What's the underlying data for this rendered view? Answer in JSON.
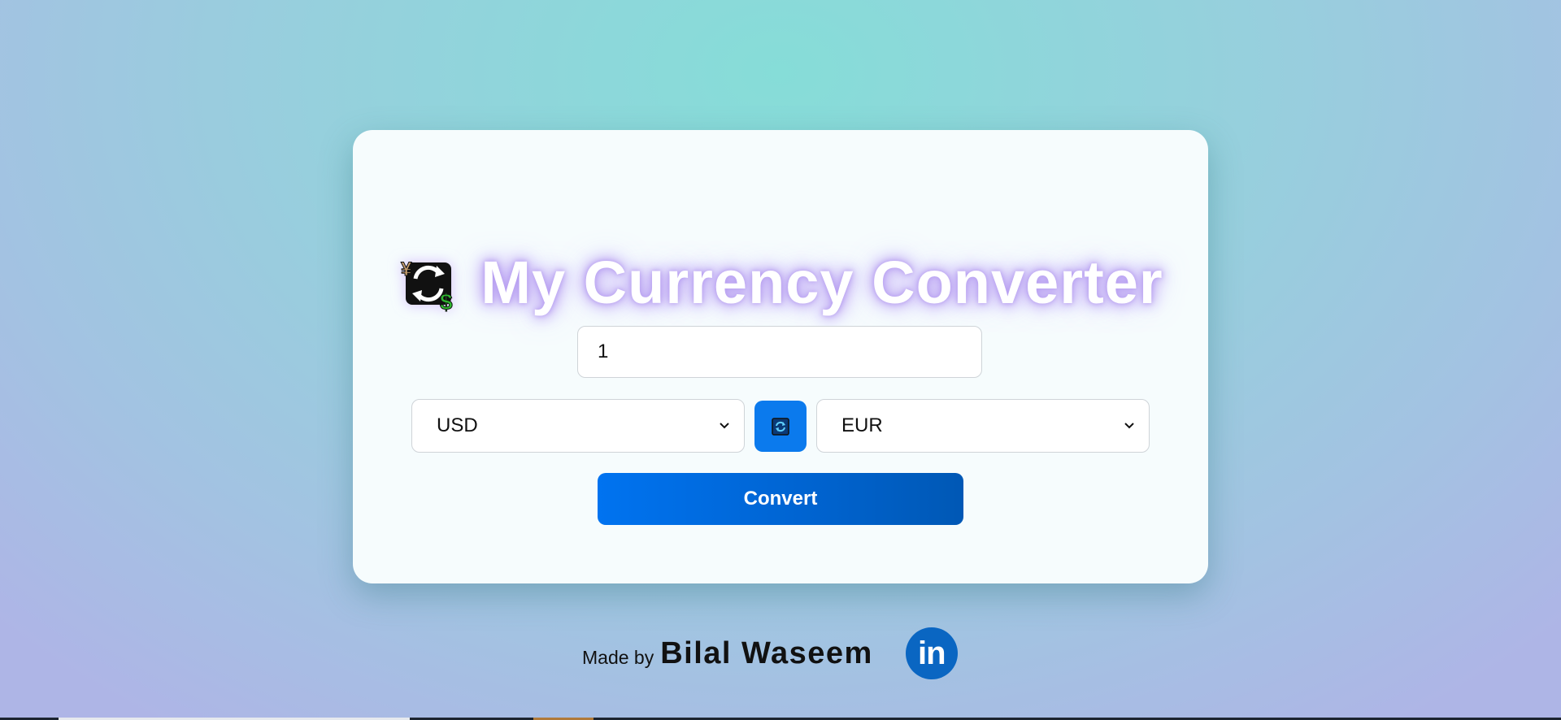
{
  "app": {
    "title": "My Currency Converter",
    "icon": "currency-exchange-icon"
  },
  "form": {
    "amount_value": "1",
    "from_currency": "USD",
    "to_currency": "EUR",
    "swap_icon": "swap-icon",
    "convert_label": "Convert"
  },
  "footer": {
    "made_by": "Made by",
    "author": "Bilal Waseem",
    "social_icon": "linkedin-icon",
    "social_text": "in"
  },
  "colors": {
    "accent": "#0b7aed",
    "linkedin": "#0a66c2",
    "title_glow": "#b59cf0"
  }
}
